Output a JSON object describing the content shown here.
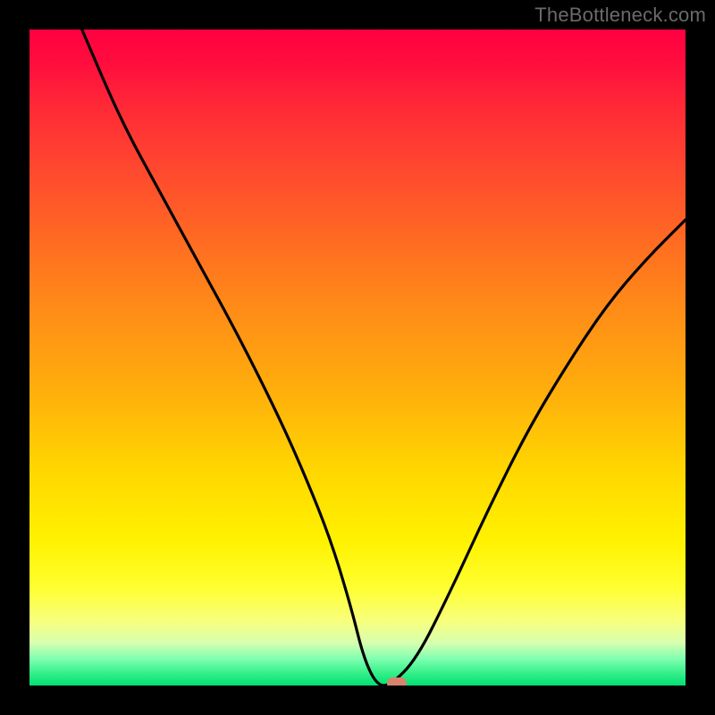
{
  "watermark": "TheBottleneck.com",
  "chart_data": {
    "type": "line",
    "title": "",
    "xlabel": "",
    "ylabel": "",
    "xlim": [
      0,
      100
    ],
    "ylim": [
      0,
      100
    ],
    "grid": false,
    "legend": false,
    "background": {
      "style": "vertical-gradient",
      "description": "performance heat gradient from red (top, high bottleneck) through orange, yellow, to green (bottom, no bottleneck)",
      "stops": [
        {
          "pos": 0,
          "color": "#ff0040"
        },
        {
          "pos": 25,
          "color": "#ff5a28"
        },
        {
          "pos": 55,
          "color": "#ffae0c"
        },
        {
          "pos": 78,
          "color": "#fff200"
        },
        {
          "pos": 93,
          "color": "#d8ffb0"
        },
        {
          "pos": 100,
          "color": "#00e074"
        }
      ]
    },
    "series": [
      {
        "name": "bottleneck-curve",
        "color": "#000000",
        "x": [
          8,
          14,
          20,
          26,
          32,
          38,
          42,
          46,
          49,
          51,
          53,
          55,
          59,
          64,
          70,
          76,
          82,
          88,
          94,
          100
        ],
        "y": [
          100,
          86,
          75,
          64,
          53,
          41,
          32,
          22,
          12,
          4,
          0,
          0,
          4,
          14,
          27,
          39,
          49,
          58,
          65,
          71
        ]
      }
    ],
    "marker": {
      "name": "optimal-point",
      "x": 56,
      "y": 0,
      "color": "#d9836f"
    }
  }
}
